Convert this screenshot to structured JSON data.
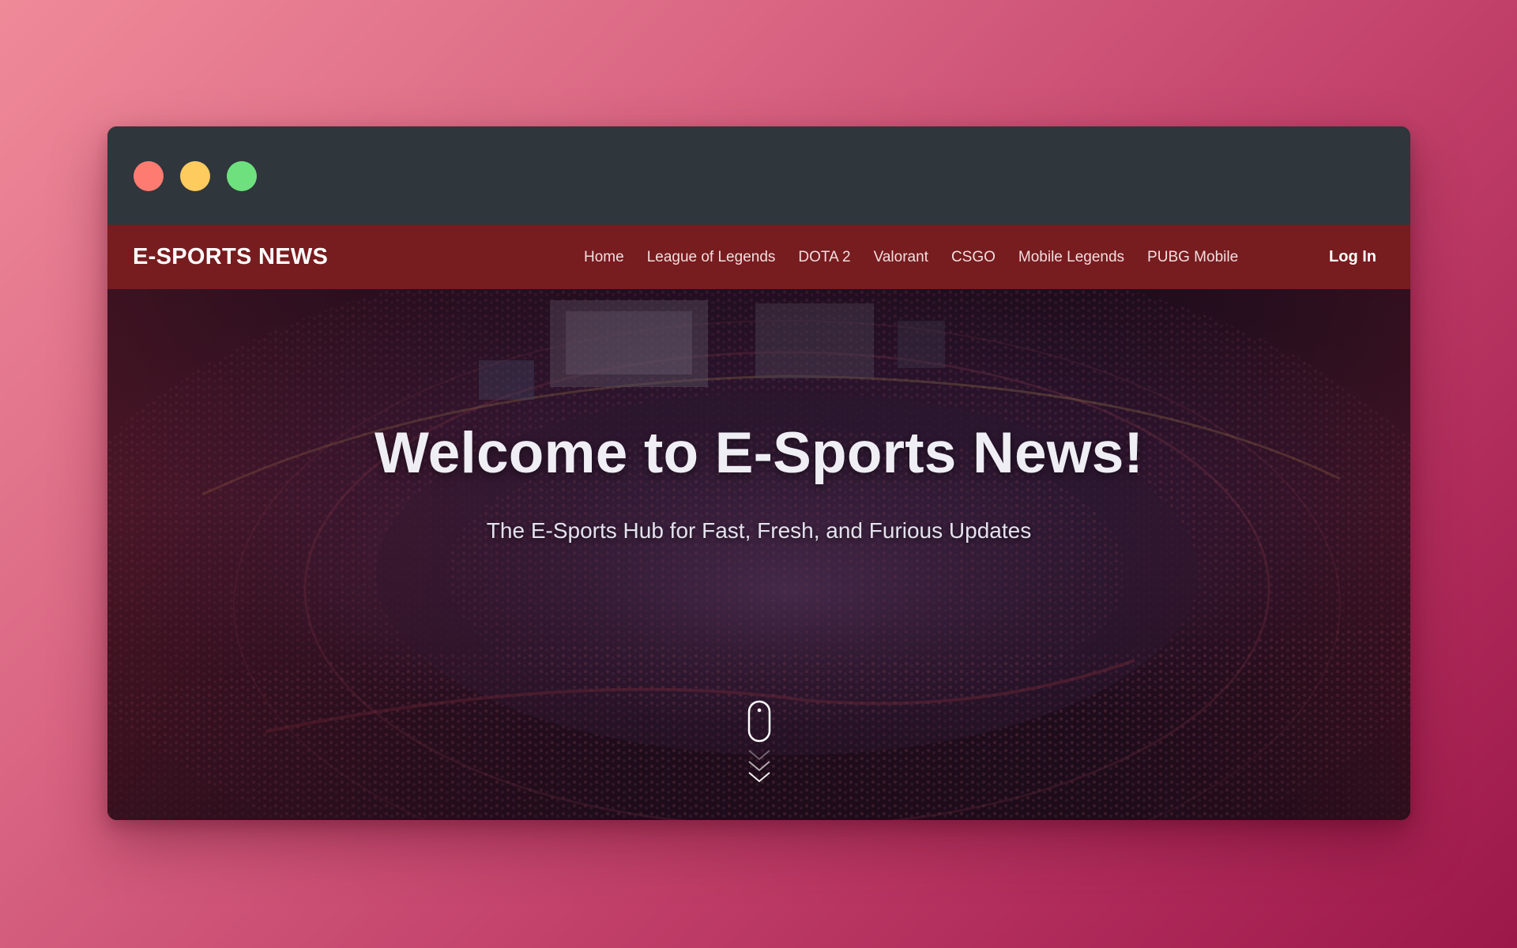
{
  "window": {
    "controls": [
      {
        "name": "close",
        "color": "#fe7b72"
      },
      {
        "name": "minimize",
        "color": "#fecb5e"
      },
      {
        "name": "maximize",
        "color": "#6ee17e"
      }
    ]
  },
  "navbar": {
    "brand": "E-SPORTS NEWS",
    "links": [
      {
        "label": "Home"
      },
      {
        "label": "League of Legends"
      },
      {
        "label": "DOTA 2"
      },
      {
        "label": "Valorant"
      },
      {
        "label": "CSGO"
      },
      {
        "label": "Mobile Legends"
      },
      {
        "label": "PUBG Mobile"
      }
    ],
    "login_label": "Log In",
    "background": "#771c1f"
  },
  "hero": {
    "title": "Welcome to E-Sports News!",
    "subtitle": "The E-Sports Hub for Fast, Fresh, and Furious Updates",
    "scroll_icon": "mouse-scroll-icon",
    "chevron_icon": "double-chevron-down-icon"
  },
  "colors": {
    "background_start": "#ef8a99",
    "background_end": "#9c1848",
    "titlebar": "#2f363c"
  }
}
